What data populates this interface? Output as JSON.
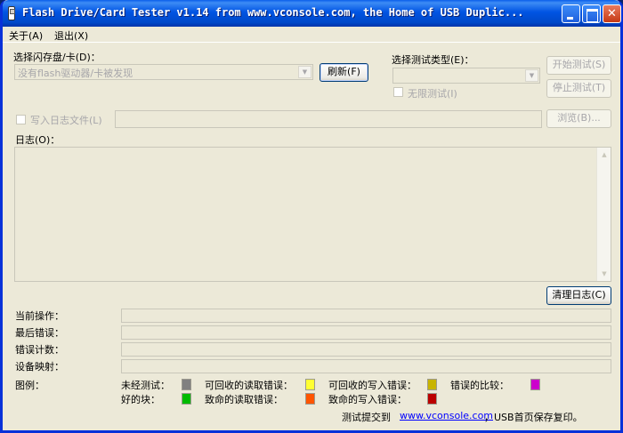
{
  "window": {
    "title": "Flash Drive/Card Tester v1.14 from www.vconsole.com, the Home of USB Duplic..."
  },
  "menu": {
    "about": "关于(A)",
    "exit": "退出(X)"
  },
  "drive_select": {
    "label": "选择闪存盘/卡(D)：",
    "value": "没有flash驱动器/卡被发现",
    "refresh_button": "刷新(F)"
  },
  "test_type": {
    "label": "选择测试类型(E)：",
    "value": "",
    "unlimited_label": "无限测试(I)"
  },
  "actions": {
    "start_button": "开始测试(S)",
    "stop_button": "停止测试(T)"
  },
  "log_file": {
    "label": "写入日志文件(L)",
    "value": "",
    "browse_button": "浏览(B)..."
  },
  "log": {
    "label": "日志(O)：",
    "clear_button": "清理日志(C)"
  },
  "status": {
    "current_operation_label": "当前操作：",
    "last_error_label": "最后错误：",
    "error_count_label": "错误计数：",
    "device_map_label": "设备映射："
  },
  "legend": {
    "label": "图例：",
    "items": [
      {
        "label": "未经测试：",
        "color": "#808080"
      },
      {
        "label": "可回收的读取错误：",
        "color": "#ffff33"
      },
      {
        "label": "可回收的写入错误：",
        "color": "#c8b400"
      },
      {
        "label": "错误的比较：",
        "color": "#cc00cc"
      },
      {
        "label": "好的块：",
        "color": "#00bb00"
      },
      {
        "label": "致命的读取错误：",
        "color": "#ff5500"
      },
      {
        "label": "致命的写入错误：",
        "color": "#bb0000"
      }
    ]
  },
  "footer": {
    "prefix": "测试提交到",
    "link": "www.vconsole.com",
    "suffix": "，USB首页保存复印。"
  }
}
